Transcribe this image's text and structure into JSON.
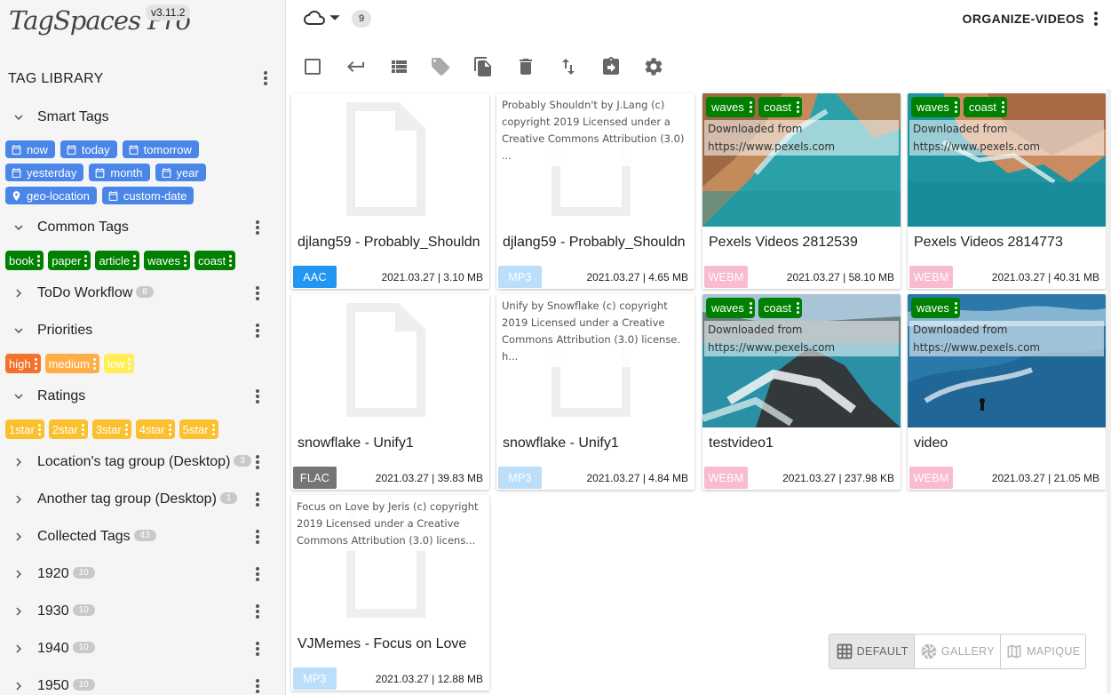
{
  "app": {
    "logo": "TagSpaces Pro",
    "version": "v3.11.2"
  },
  "sidebar": {
    "title": "TAG LIBRARY",
    "groups": [
      {
        "name": "Smart Tags",
        "expanded": true,
        "count": ""
      },
      {
        "name": "Common Tags",
        "expanded": true,
        "count": ""
      },
      {
        "name": "ToDo Workflow",
        "expanded": false,
        "count": "8"
      },
      {
        "name": "Priorities",
        "expanded": true,
        "count": ""
      },
      {
        "name": "Ratings",
        "expanded": true,
        "count": ""
      },
      {
        "name": "Location's tag group (Desktop)",
        "expanded": false,
        "count": "3"
      },
      {
        "name": "Another tag group (Desktop)",
        "expanded": false,
        "count": "1"
      },
      {
        "name": "Collected Tags",
        "expanded": false,
        "count": "43"
      },
      {
        "name": "1920",
        "expanded": false,
        "count": "10"
      },
      {
        "name": "1930",
        "expanded": false,
        "count": "10"
      },
      {
        "name": "1940",
        "expanded": false,
        "count": "10"
      },
      {
        "name": "1950",
        "expanded": false,
        "count": "10"
      }
    ],
    "smart_tags": [
      {
        "label": "now",
        "icon": "calendar-icon"
      },
      {
        "label": "today",
        "icon": "calendar-icon"
      },
      {
        "label": "tomorrow",
        "icon": "calendar-icon"
      },
      {
        "label": "yesterday",
        "icon": "calendar-icon"
      },
      {
        "label": "month",
        "icon": "calendar-icon"
      },
      {
        "label": "year",
        "icon": "calendar-icon"
      },
      {
        "label": "geo-location",
        "icon": "location-pin-icon"
      },
      {
        "label": "custom-date",
        "icon": "calendar-icon"
      }
    ],
    "common_tags": [
      "book",
      "paper",
      "article",
      "waves",
      "coast"
    ],
    "priority_tags": [
      {
        "label": "high",
        "color": "#f4712b"
      },
      {
        "label": "medium",
        "color": "#ffad46"
      },
      {
        "label": "low",
        "color": "#ffee55"
      }
    ],
    "rating_tags": [
      "1star",
      "2star",
      "3star",
      "4star",
      "5star"
    ],
    "colors": {
      "smart": "#4a86e8",
      "common": "#008000",
      "rating": "#fbc02d"
    }
  },
  "header": {
    "location": "ORGANIZE-VIDEOS",
    "file_count": "9"
  },
  "toolbar": [
    "select-all-icon",
    "back-icon",
    "list-view-icon",
    "tag-icon",
    "copy-icon",
    "delete-icon",
    "sort-icon",
    "export-icon",
    "settings-icon"
  ],
  "files": [
    {
      "title": "djlang59 - Probably_Shouldn",
      "ext": "AAC",
      "ext_color": "#2196f3",
      "meta": "2021.03.27 | 3.10 MB",
      "thumb": "placeholder",
      "description": "",
      "tags": []
    },
    {
      "title": "djlang59 - Probably_Shouldn",
      "ext": "MP3",
      "ext_color": "#bbdefb",
      "meta": "2021.03.27 | 4.65 MB",
      "thumb": "placeholder",
      "description": "Probably Shouldn't by J.Lang (c) copyright 2019 Licensed under a Creative Commons Attribution (3.0) ...",
      "tags": []
    },
    {
      "title": "Pexels Videos 2812539",
      "ext": "WEBM",
      "ext_color": "#f8bbd0",
      "meta": "2021.03.27 | 58.10 MB",
      "thumb": "coast-aerial",
      "description": "Downloaded from https://www.pexels.com",
      "tags": [
        "waves",
        "coast"
      ]
    },
    {
      "title": "Pexels Videos 2814773",
      "ext": "WEBM",
      "ext_color": "#f8bbd0",
      "meta": "2021.03.27 | 40.31 MB",
      "thumb": "coast-aerial-2",
      "description": "Downloaded from https://www.pexels.com",
      "tags": [
        "waves",
        "coast"
      ]
    },
    {
      "title": "snowflake - Unify1",
      "ext": "FLAC",
      "ext_color": "#757575",
      "meta": "2021.03.27 | 39.83 MB",
      "thumb": "placeholder",
      "description": "",
      "tags": []
    },
    {
      "title": "snowflake - Unify1",
      "ext": "MP3",
      "ext_color": "#bbdefb",
      "meta": "2021.03.27 | 4.84 MB",
      "thumb": "placeholder",
      "description": "Unify by Snowflake (c) copyright 2019 Licensed under a Creative Commons Attribution (3.0) license. h...",
      "tags": []
    },
    {
      "title": "testvideo1",
      "ext": "WEBM",
      "ext_color": "#f8bbd0",
      "meta": "2021.03.27 | 237.98 KB",
      "thumb": "cliff-waves",
      "description": "Downloaded from https://www.pexels.com",
      "tags": [
        "waves",
        "coast"
      ]
    },
    {
      "title": "video",
      "ext": "WEBM",
      "ext_color": "#f8bbd0",
      "meta": "2021.03.27 | 21.05 MB",
      "thumb": "surfer",
      "description": "Downloaded from https://www.pexels.com",
      "tags": [
        "waves"
      ]
    },
    {
      "title": "VJMemes - Focus on Love",
      "ext": "MP3",
      "ext_color": "#bbdefb",
      "meta": "2021.03.27 | 12.88 MB",
      "thumb": "placeholder",
      "description": "Focus on Love by Jeris (c) copyright 2019 Licensed under a Creative Commons Attribution (3.0) licens...",
      "tags": []
    }
  ],
  "view_switcher": [
    {
      "label": "DEFAULT",
      "icon": "grid-icon",
      "active": true
    },
    {
      "label": "GALLERY",
      "icon": "camera-aperture-icon",
      "active": false
    },
    {
      "label": "MAPIQUE",
      "icon": "map-icon",
      "active": false
    }
  ]
}
